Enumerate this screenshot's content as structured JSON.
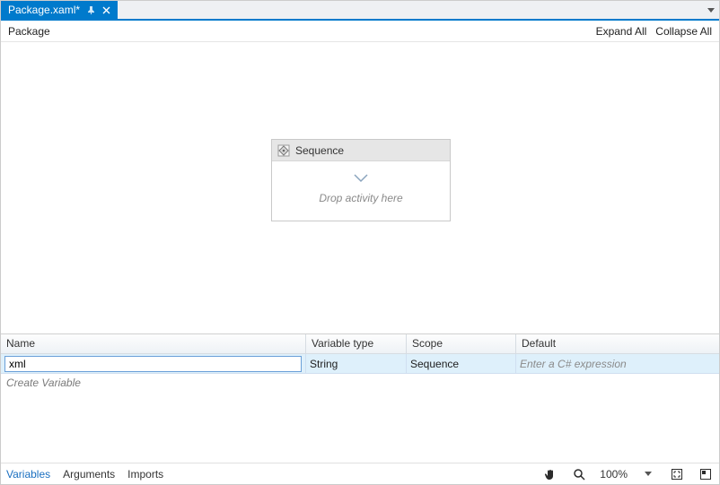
{
  "tab": {
    "title": "Package.xaml*",
    "pin_icon": "pin-icon",
    "close_icon": "close-icon"
  },
  "tabrow": {
    "menu_icon": "chevron-down-icon"
  },
  "toolbar": {
    "breadcrumb": "Package",
    "expand_all": "Expand All",
    "collapse_all": "Collapse All"
  },
  "canvas": {
    "activity": {
      "title": "Sequence",
      "drop_hint": "Drop activity here"
    }
  },
  "variables": {
    "headers": {
      "name": "Name",
      "type": "Variable type",
      "scope": "Scope",
      "default": "Default"
    },
    "rows": [
      {
        "name": "xml",
        "type": "String",
        "scope": "Sequence",
        "default_placeholder": "Enter a C# expression"
      }
    ],
    "create_label": "Create Variable"
  },
  "bottom": {
    "tabs": {
      "variables": "Variables",
      "arguments": "Arguments",
      "imports": "Imports"
    },
    "zoom": "100%",
    "icons": {
      "pan": "hand-icon",
      "zoom": "magnifier-icon",
      "fit": "fit-to-screen-icon",
      "overview": "overview-icon",
      "menu": "chevron-down-icon"
    }
  }
}
